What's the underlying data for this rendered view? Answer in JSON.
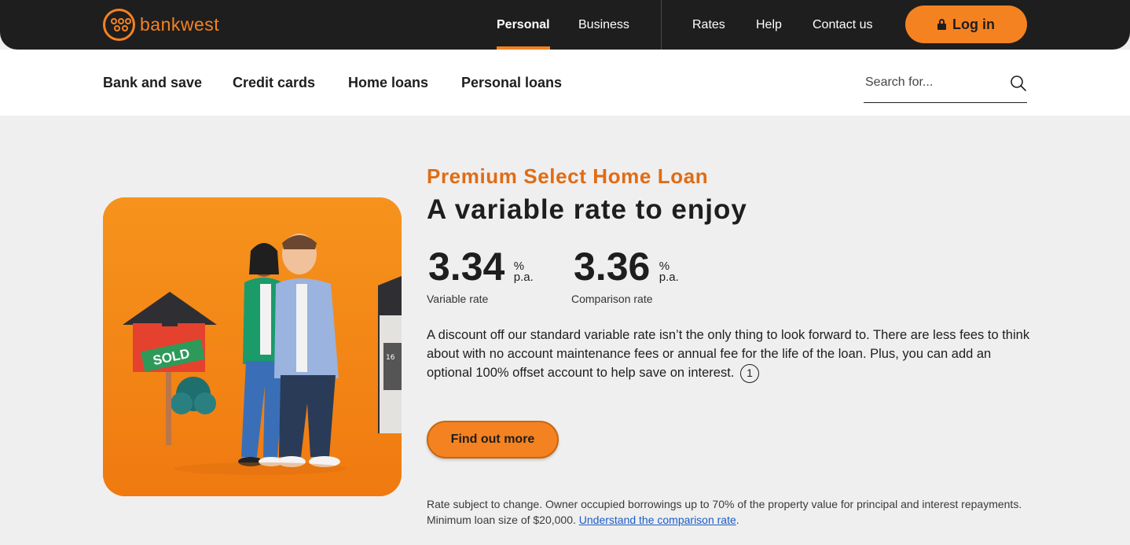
{
  "brand": {
    "name": "bankwest",
    "accent": "#f58220"
  },
  "top_nav": {
    "personal": "Personal",
    "business": "Business",
    "rates": "Rates",
    "help": "Help",
    "contact": "Contact us",
    "login": "Log in"
  },
  "sub_nav": {
    "items": [
      "Bank and save",
      "Credit cards",
      "Home loans",
      "Personal loans"
    ],
    "search_placeholder": "Search for..."
  },
  "hero": {
    "image_description": "3D illustration of smiling couple in front of house with SOLD sign",
    "image_sign_text": "SOLD",
    "image_house_number": "16",
    "eyebrow": "Premium Select Home Loan",
    "headline": "A variable rate to enjoy",
    "rates": [
      {
        "value": "3.34",
        "unit_top": "%",
        "unit_bottom": "p.a.",
        "label": "Variable rate"
      },
      {
        "value": "3.36",
        "unit_top": "%",
        "unit_bottom": "p.a.",
        "label": "Comparison rate"
      }
    ],
    "body": "A discount off our standard variable rate isn’t the only thing to look forward to. There are less fees to think about with no account maintenance fees or annual fee for the life of the loan. Plus, you can add an optional 100% offset account to help save on interest.",
    "footnote_marker": "1",
    "cta": "Find out more",
    "disclaimer": "Rate subject to change. Owner occupied borrowings up to 70% of the property value for principal and interest repayments. Minimum loan size of $20,000.",
    "disclaimer_link": "Understand the comparison rate",
    "disclaimer_end": "."
  }
}
